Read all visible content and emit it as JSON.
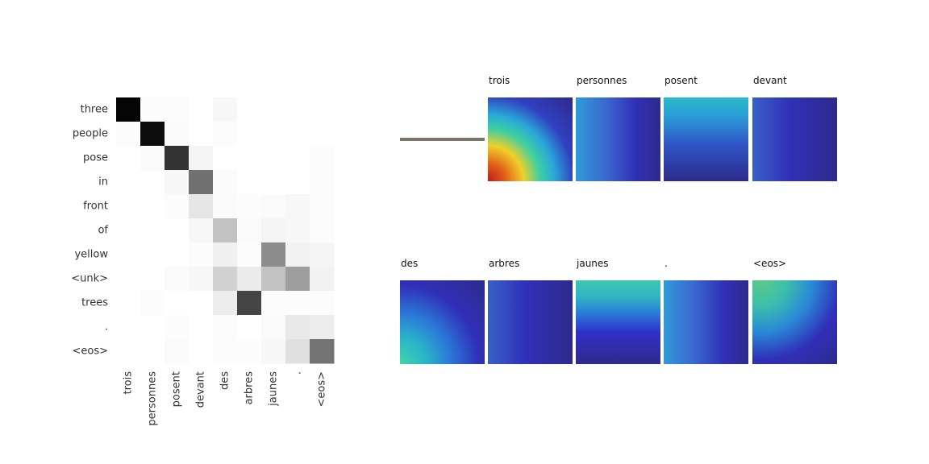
{
  "chart_data": [
    {
      "type": "heatmap",
      "title": "",
      "rows": [
        "three",
        "people",
        "pose",
        "in",
        "front",
        "of",
        "yellow",
        "<unk>",
        "trees",
        ".",
        "<eos>"
      ],
      "columns": [
        "trois",
        "personnes",
        "posent",
        "devant",
        "des",
        "arbres",
        "jaunes",
        ".",
        "<eos>"
      ],
      "values": [
        [
          0.98,
          0.01,
          0.01,
          0.0,
          0.03,
          0.0,
          0.0,
          0.0,
          0.0
        ],
        [
          0.01,
          0.95,
          0.02,
          0.0,
          0.01,
          0.0,
          0.0,
          0.0,
          0.0
        ],
        [
          0.0,
          0.02,
          0.8,
          0.04,
          0.0,
          0.0,
          0.0,
          0.0,
          0.01
        ],
        [
          0.0,
          0.0,
          0.03,
          0.56,
          0.02,
          0.0,
          0.0,
          0.0,
          0.01
        ],
        [
          0.0,
          0.0,
          0.01,
          0.1,
          0.02,
          0.01,
          0.02,
          0.03,
          0.01
        ],
        [
          0.0,
          0.0,
          0.0,
          0.03,
          0.24,
          0.02,
          0.04,
          0.03,
          0.01
        ],
        [
          0.0,
          0.0,
          0.0,
          0.01,
          0.06,
          0.01,
          0.45,
          0.05,
          0.04
        ],
        [
          0.0,
          0.0,
          0.02,
          0.03,
          0.18,
          0.08,
          0.24,
          0.38,
          0.05
        ],
        [
          0.0,
          0.01,
          0.0,
          0.0,
          0.07,
          0.73,
          0.01,
          0.01,
          0.01
        ],
        [
          0.0,
          0.0,
          0.01,
          0.0,
          0.01,
          0.0,
          0.02,
          0.09,
          0.07
        ],
        [
          0.0,
          0.0,
          0.02,
          0.0,
          0.01,
          0.01,
          0.03,
          0.12,
          0.55
        ]
      ],
      "colormap": "greys",
      "grid": false
    },
    {
      "type": "heatmap",
      "title": "",
      "layout": "2 rows x 5 columns of attention maps over the input image",
      "panels": [
        {
          "label": "",
          "blank": true
        },
        {
          "label": "trois",
          "heat": "strong warm focus at bottom-left"
        },
        {
          "label": "personnes",
          "heat": "weak focus on left side"
        },
        {
          "label": "posent",
          "heat": "weak focus along top"
        },
        {
          "label": "devant",
          "heat": "uniform low"
        },
        {
          "label": "des",
          "heat": "moderate focus at bottom-left"
        },
        {
          "label": "arbres",
          "heat": "uniform low"
        },
        {
          "label": "jaunes",
          "heat": "moderate focus along top band"
        },
        {
          "label": ".",
          "heat": "weak focus on left side"
        },
        {
          "label": "<eos>",
          "heat": "moderate focus at top-left"
        }
      ]
    }
  ],
  "colors": {
    "text": "#333333",
    "cold": "#2e2a8c",
    "cyan": "#2ac3c0",
    "warm": "#e04020",
    "blank_line": "#7a7566"
  }
}
